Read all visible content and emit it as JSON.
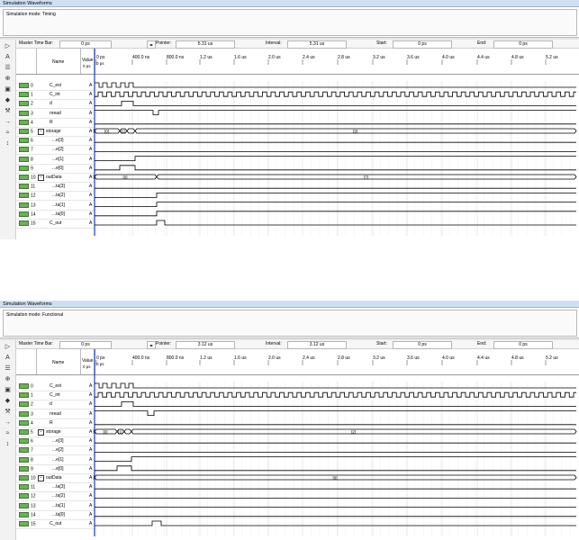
{
  "panels": [
    {
      "title": "Simulation Waveforms",
      "mode_text": "Simulation mode: Timing",
      "master_time_bar": {
        "label": "Master Time Bar:",
        "value": "0 ps"
      },
      "pointer": {
        "label": "Pointer:",
        "value": "5.31 us"
      },
      "interval": {
        "label": "Interval:",
        "value": "5.31 us"
      },
      "start": {
        "label": "Start:",
        "value": "0 ps"
      },
      "end": {
        "label": "End:",
        "value": "0 ps"
      },
      "header": {
        "name": "Name",
        "value": "Value",
        "value_sub": "0 ps",
        "time_zero": "0 ps"
      },
      "ticks": [
        "0 ps",
        "400.0 ns",
        "800.0 ns",
        "1.2 us",
        "1.6 us",
        "2.0 us",
        "2.4 us",
        "2.8 us",
        "3.2 us",
        "3.6 us",
        "4.0 us",
        "4.4 us",
        "4.8 us",
        "5.2 us"
      ],
      "signals": [
        {
          "idx": "0",
          "name": "C_ext",
          "value": "A"
        },
        {
          "idx": "1",
          "name": "C_int",
          "value": "A"
        },
        {
          "idx": "2",
          "name": "d",
          "value": "A"
        },
        {
          "idx": "3",
          "name": "nread",
          "value": "A"
        },
        {
          "idx": "4",
          "name": "R",
          "value": "A"
        },
        {
          "idx": "5",
          "name": "storage",
          "value": "A [",
          "group": true
        },
        {
          "idx": "6",
          "name": "...e[3]",
          "value": "A",
          "child": true
        },
        {
          "idx": "7",
          "name": "...e[2]",
          "value": "A",
          "child": true
        },
        {
          "idx": "8",
          "name": "...e[1]",
          "value": "A",
          "child": true
        },
        {
          "idx": "9",
          "name": "...e[0]",
          "value": "A",
          "child": true
        },
        {
          "idx": "10",
          "name": "outData",
          "value": "A [",
          "group": true
        },
        {
          "idx": "11",
          "name": "...ta[3]",
          "value": "A",
          "child": true
        },
        {
          "idx": "12",
          "name": "...ta[2]",
          "value": "A",
          "child": true
        },
        {
          "idx": "13",
          "name": "...ta[1]",
          "value": "A",
          "child": true
        },
        {
          "idx": "14",
          "name": "...ta[0]",
          "value": "A",
          "child": true
        },
        {
          "idx": "15",
          "name": "C_out",
          "value": "A"
        }
      ],
      "bus_labels": {
        "storage": [
          "[0]",
          "[1]",
          "[3]"
        ],
        "outData": [
          "[0]",
          "[7]"
        ]
      }
    },
    {
      "title": "Simulation Waveforms",
      "mode_text": "Simulation mode: Functional",
      "master_time_bar": {
        "label": "Master Time Bar:",
        "value": "0 ps"
      },
      "pointer": {
        "label": "Pointer:",
        "value": "3.12 us"
      },
      "interval": {
        "label": "Interval:",
        "value": "3.12 us"
      },
      "start": {
        "label": "Start:",
        "value": "0 ps"
      },
      "end": {
        "label": "End:",
        "value": "0 ps"
      },
      "header": {
        "name": "Name",
        "value": "Value",
        "value_sub": "0 ps",
        "time_zero": "0 ps"
      },
      "ticks": [
        "0 ps",
        "400.0 ns",
        "800.0 ns",
        "1.2 us",
        "1.6 us",
        "2.0 us",
        "2.4 us",
        "2.8 us",
        "3.2 us",
        "3.6 us",
        "4.0 us",
        "4.4 us",
        "4.8 us",
        "5.2 us"
      ],
      "signals": [
        {
          "idx": "0",
          "name": "C_ext",
          "value": "A"
        },
        {
          "idx": "1",
          "name": "C_int",
          "value": "A"
        },
        {
          "idx": "2",
          "name": "d",
          "value": "A"
        },
        {
          "idx": "3",
          "name": "nread",
          "value": "A"
        },
        {
          "idx": "4",
          "name": "R",
          "value": "A"
        },
        {
          "idx": "5",
          "name": "storage",
          "value": "A [",
          "group": true
        },
        {
          "idx": "6",
          "name": "...e[3]",
          "value": "A",
          "child": true
        },
        {
          "idx": "7",
          "name": "...e[2]",
          "value": "A",
          "child": true
        },
        {
          "idx": "8",
          "name": "...e[1]",
          "value": "A",
          "child": true
        },
        {
          "idx": "9",
          "name": "...e[0]",
          "value": "A",
          "child": true
        },
        {
          "idx": "10",
          "name": "outData",
          "value": "A [",
          "group": true
        },
        {
          "idx": "11",
          "name": "...ta[3]",
          "value": "A",
          "child": true
        },
        {
          "idx": "12",
          "name": "...ta[2]",
          "value": "A",
          "child": true
        },
        {
          "idx": "13",
          "name": "...ta[1]",
          "value": "A",
          "child": true
        },
        {
          "idx": "14",
          "name": "...ta[0]",
          "value": "A",
          "child": true
        },
        {
          "idx": "15",
          "name": "C_out",
          "value": "A"
        }
      ],
      "bus_labels": {
        "storage": [
          "[0]",
          "[1]",
          "[2]"
        ],
        "outData": [
          "[0]"
        ]
      }
    }
  ],
  "toolbar_icons": [
    "pointer-icon",
    "text-tool-icon",
    "waveform-editing-icon",
    "zoom-icon",
    "fullscreen-icon",
    "find-icon",
    "replace-icon",
    "assign-icon",
    "overwrite-icon",
    "sort-icon"
  ]
}
